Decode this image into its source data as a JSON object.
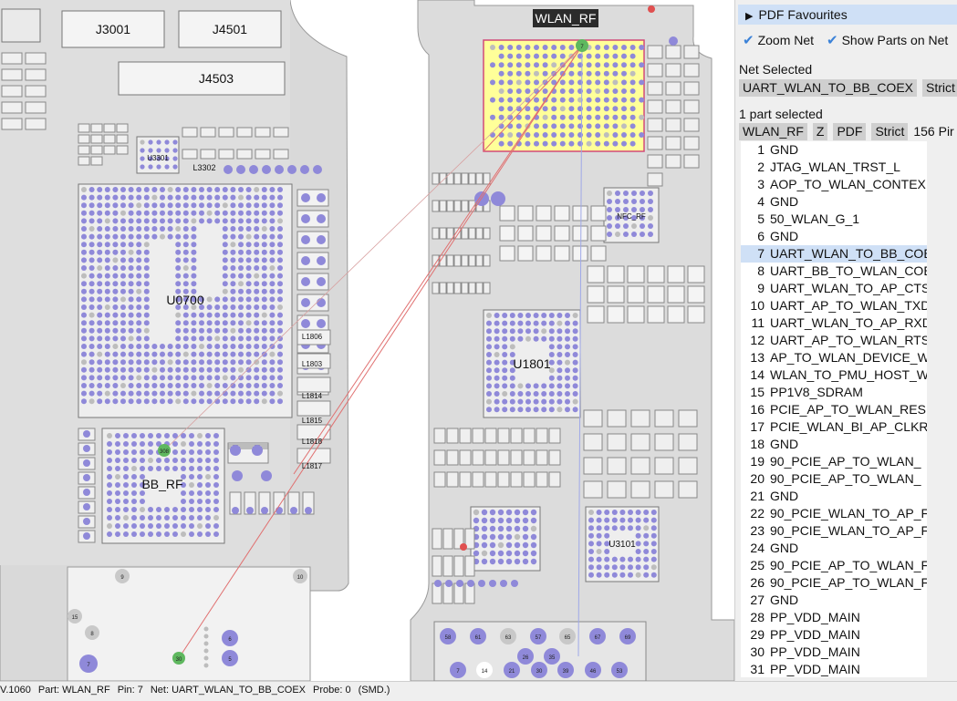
{
  "board": {
    "labels": [
      {
        "name": "j3001",
        "text": "J3001"
      },
      {
        "name": "j4501",
        "text": "J4501"
      },
      {
        "name": "j4503",
        "text": "J4503"
      },
      {
        "name": "u3301",
        "text": "U3301"
      },
      {
        "name": "l3302",
        "text": "L3302"
      },
      {
        "name": "u0700",
        "text": "U0700"
      },
      {
        "name": "bb-rf",
        "text": "BB_RF"
      },
      {
        "name": "l1806",
        "text": "L1806"
      },
      {
        "name": "l1803",
        "text": "L1803"
      },
      {
        "name": "l1814",
        "text": "L1814"
      },
      {
        "name": "l1815",
        "text": "L1815"
      },
      {
        "name": "l1818",
        "text": "L1818"
      },
      {
        "name": "l1817",
        "text": "L1817"
      },
      {
        "name": "wlan-rf",
        "text": "WLAN_RF"
      },
      {
        "name": "nfc-rf",
        "text": "NFC_RF"
      },
      {
        "name": "u1801",
        "text": "U1801"
      },
      {
        "name": "u3101",
        "text": "U3101"
      }
    ],
    "pin_marks": [
      "7",
      "308",
      "30",
      "9",
      "10",
      "15",
      "8",
      "7",
      "6",
      "5",
      "58",
      "61",
      "63",
      "57",
      "65",
      "67",
      "69",
      "26",
      "35",
      "7",
      "14",
      "21",
      "30",
      "39",
      "46",
      "53"
    ],
    "colors": {
      "pad": "#8f89d9",
      "highlight": "#ffff99",
      "connector": "#5fb85f",
      "net_line": "#e07070"
    }
  },
  "panel": {
    "favourites_label": "PDF Favourites",
    "zoom_net_label": "Zoom Net",
    "show_parts_label": "Show Parts on Net",
    "net_selected_label": "Net Selected",
    "net_name": "UART_WLAN_TO_BB_COEX",
    "net_strict_label": "Strict",
    "parts_selected_label": "1 part selected",
    "part_name": "WLAN_RF",
    "z_label": "Z",
    "pdf_label": "PDF",
    "part_strict_label": "Strict",
    "pin_count": "156 Pir",
    "selected_pin_index": 6,
    "pins": [
      {
        "n": "1",
        "net": "GND"
      },
      {
        "n": "2",
        "net": "JTAG_WLAN_TRST_L"
      },
      {
        "n": "3",
        "net": "AOP_TO_WLAN_CONTEX"
      },
      {
        "n": "4",
        "net": "GND"
      },
      {
        "n": "5",
        "net": "50_WLAN_G_1"
      },
      {
        "n": "6",
        "net": "GND"
      },
      {
        "n": "7",
        "net": "UART_WLAN_TO_BB_COE"
      },
      {
        "n": "8",
        "net": "UART_BB_TO_WLAN_COE"
      },
      {
        "n": "9",
        "net": "UART_WLAN_TO_AP_CTS"
      },
      {
        "n": "10",
        "net": "UART_AP_TO_WLAN_TXD"
      },
      {
        "n": "11",
        "net": "UART_WLAN_TO_AP_RXD"
      },
      {
        "n": "12",
        "net": "UART_AP_TO_WLAN_RTS"
      },
      {
        "n": "13",
        "net": "AP_TO_WLAN_DEVICE_W"
      },
      {
        "n": "14",
        "net": "WLAN_TO_PMU_HOST_W"
      },
      {
        "n": "15",
        "net": "PP1V8_SDRAM"
      },
      {
        "n": "16",
        "net": "PCIE_AP_TO_WLAN_RES"
      },
      {
        "n": "17",
        "net": "PCIE_WLAN_BI_AP_CLKR"
      },
      {
        "n": "18",
        "net": "GND"
      },
      {
        "n": "19",
        "net": "90_PCIE_AP_TO_WLAN_"
      },
      {
        "n": "20",
        "net": "90_PCIE_AP_TO_WLAN_"
      },
      {
        "n": "21",
        "net": "GND"
      },
      {
        "n": "22",
        "net": "90_PCIE_WLAN_TO_AP_F"
      },
      {
        "n": "23",
        "net": "90_PCIE_WLAN_TO_AP_F"
      },
      {
        "n": "24",
        "net": "GND"
      },
      {
        "n": "25",
        "net": "90_PCIE_AP_TO_WLAN_F"
      },
      {
        "n": "26",
        "net": "90_PCIE_AP_TO_WLAN_F"
      },
      {
        "n": "27",
        "net": "GND"
      },
      {
        "n": "28",
        "net": "PP_VDD_MAIN"
      },
      {
        "n": "29",
        "net": "PP_VDD_MAIN"
      },
      {
        "n": "30",
        "net": "PP_VDD_MAIN"
      },
      {
        "n": "31",
        "net": "PP_VDD_MAIN"
      }
    ]
  },
  "status": {
    "version": "V.1060",
    "part": "Part: WLAN_RF",
    "pin": "Pin: 7",
    "net": "Net: UART_WLAN_TO_BB_COEX",
    "probe": "Probe: 0",
    "smd": "(SMD.)"
  }
}
